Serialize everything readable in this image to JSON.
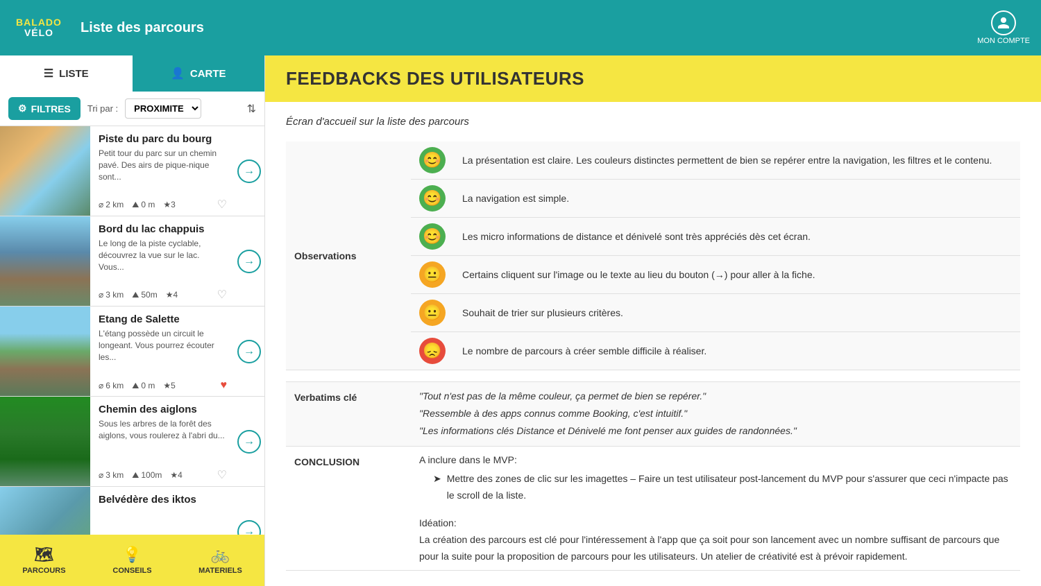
{
  "app": {
    "logo_line1": "BALADO",
    "logo_line2": "VÉLO",
    "header_title": "Liste des parcours",
    "user_label": "MON COMPTE"
  },
  "tabs": {
    "liste_label": "LISTE",
    "carte_label": "CARTE"
  },
  "filters": {
    "button_label": "FILTRES",
    "tri_label": "Tri par :",
    "tri_value": "PROXIMITE"
  },
  "parcours": [
    {
      "name": "Piste du parc du bourg",
      "desc": "Petit tour du parc sur un chemin pavé. Des airs de pique-nique sont...",
      "distance": "2 km",
      "denivele": "0 m",
      "stars": "★3",
      "heart": "empty",
      "img_class": "img-parc"
    },
    {
      "name": "Bord du lac chappuis",
      "desc": "Le long de la piste cyclable, découvrez la vue sur le lac. Vous...",
      "distance": "3 km",
      "denivele": "50m",
      "stars": "★4",
      "heart": "empty",
      "img_class": "img-lac"
    },
    {
      "name": "Etang de Salette",
      "desc": "L'étang possède un circuit le longeant. Vous pourrez écouter les...",
      "distance": "6 km",
      "denivele": "0 m",
      "stars": "★5",
      "heart": "full",
      "img_class": "img-salette"
    },
    {
      "name": "Chemin des aiglons",
      "desc": "Sous les arbres de la forêt des aiglons, vous roulerez à l'abri du...",
      "distance": "3 km",
      "denivele": "100m",
      "stars": "★4",
      "heart": "empty",
      "img_class": "img-aiglons"
    },
    {
      "name": "Belvédère des iktos",
      "desc": "",
      "distance": "",
      "denivele": "",
      "stars": "",
      "heart": "empty",
      "img_class": "img-belveder"
    }
  ],
  "bottom_nav": [
    {
      "label": "PARCOURS",
      "icon": "🗺"
    },
    {
      "label": "CONSEILS",
      "icon": "💡"
    },
    {
      "label": "MATERIELS",
      "icon": "🚲"
    }
  ],
  "feedback": {
    "title": "FEEDBACKS DES UTILISATEURS",
    "screen_label": "Écran d'accueil sur la liste des parcours",
    "observations_label": "Observations",
    "observations": [
      {
        "emoji_type": "green",
        "emoji": "😊",
        "text": "La présentation est claire. Les couleurs distinctes permettent de bien se repérer entre la navigation, les filtres et le contenu."
      },
      {
        "emoji_type": "green",
        "emoji": "😊",
        "text": "La navigation est simple."
      },
      {
        "emoji_type": "green",
        "emoji": "😊",
        "text": "Les micro informations de distance et dénivelé sont très appréciés dès cet écran."
      },
      {
        "emoji_type": "yellow",
        "emoji": "😐",
        "text": "Certains cliquent sur l'image ou le texte au lieu du bouton (→) pour aller à la fiche."
      },
      {
        "emoji_type": "yellow",
        "emoji": "😐",
        "text": "Souhait de trier sur plusieurs critères."
      },
      {
        "emoji_type": "red",
        "emoji": "😞",
        "text": "Le nombre de parcours à créer semble difficile à réaliser."
      }
    ],
    "verbatims_label": "Verbatims clé",
    "verbatims": [
      "\"Tout n'est pas de la même couleur, ça permet de bien se repérer.\"",
      "\"Ressemble à des apps connus comme Booking, c'est intuitif.\"",
      "\"Les informations clés Distance et Dénivelé me font penser aux guides de randonnées.\""
    ],
    "conclusion_label": "CONCLUSION",
    "conclusion_mvp_intro": "A inclure dans le MVP:",
    "conclusion_mvp_point": "Mettre des zones de clic sur les imagettes – Faire un test utilisateur post-lancement du MVP pour s'assurer que ceci n'impacte pas le scroll de la liste.",
    "conclusion_ideation_label": "Idéation:",
    "conclusion_ideation_text": "La création des parcours est clé pour l'intéressement à l'app que ça soit pour son lancement avec un nombre suffisant de parcours que pour la suite pour la proposition de parcours pour les utilisateurs. Un atelier de créativité est à prévoir rapidement."
  }
}
